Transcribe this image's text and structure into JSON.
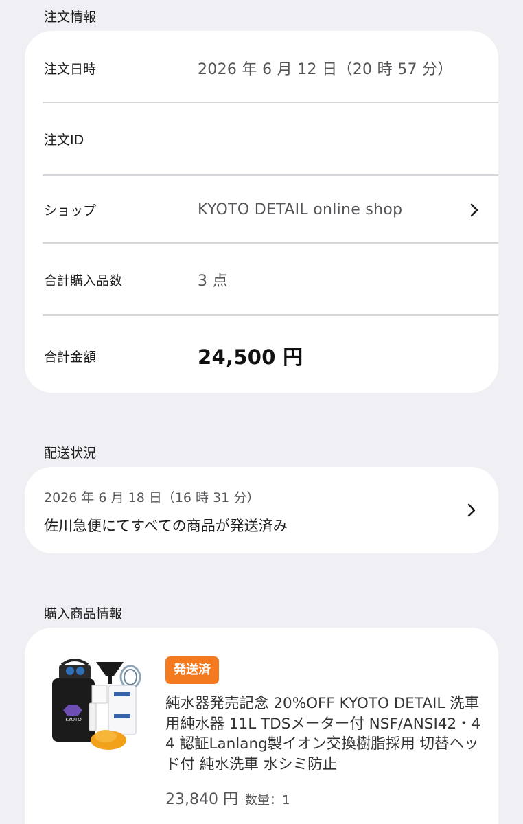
{
  "order_info": {
    "section_title": "注文情報",
    "rows": [
      {
        "label": "注文日時",
        "value": "2026 年 6 月 12 日（20 時 57 分）"
      },
      {
        "label": "注文ID",
        "value": ""
      },
      {
        "label": "ショップ",
        "value": "KYOTO DETAIL online shop"
      },
      {
        "label": "合計購入品数",
        "value": "3 点"
      },
      {
        "label": "合計金額",
        "value": "24,500 円"
      }
    ]
  },
  "shipping": {
    "section_title": "配送状況",
    "date": "2026 年 6 月 18 日（16 時 31 分）",
    "status": "佐川急便にてすべての商品が発送済み"
  },
  "products": {
    "section_title": "購入商品情報",
    "items": [
      {
        "badge": "発送済",
        "title": "純水器発売記念 20%OFF KYOTO DETAIL 洗車用純水器 11L TDSメーター付 NSF/ANSI42・44 認証Lanlang製イオン交換樹脂採用 切替ヘッド付 純水洗車 水シミ防止",
        "price": "23,840 円",
        "quantity": "数量：1",
        "badge_color": "#f47a1f"
      }
    ]
  },
  "icons": {
    "chevron": "chevron-right-icon",
    "product_image": "water-purifier-product-image"
  }
}
